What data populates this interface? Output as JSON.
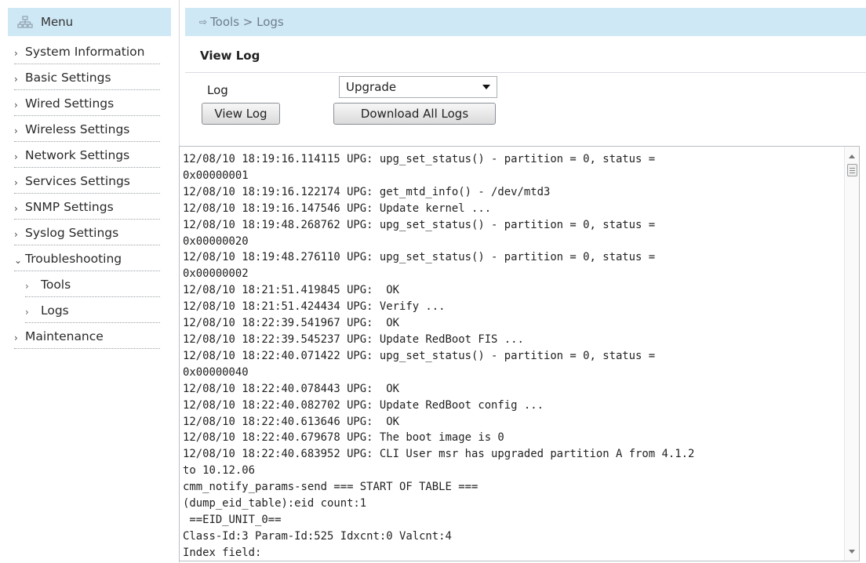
{
  "sidebar": {
    "menu_title": "Menu",
    "items": [
      {
        "label": "System Information",
        "sub": false,
        "expanded": false
      },
      {
        "label": "Basic Settings",
        "sub": false,
        "expanded": false
      },
      {
        "label": "Wired Settings",
        "sub": false,
        "expanded": false
      },
      {
        "label": "Wireless Settings",
        "sub": false,
        "expanded": false
      },
      {
        "label": "Network Settings",
        "sub": false,
        "expanded": false
      },
      {
        "label": "Services Settings",
        "sub": false,
        "expanded": false
      },
      {
        "label": "SNMP Settings",
        "sub": false,
        "expanded": false
      },
      {
        "label": "Syslog Settings",
        "sub": false,
        "expanded": false
      },
      {
        "label": "Troubleshooting",
        "sub": false,
        "expanded": true
      },
      {
        "label": "Tools",
        "sub": true,
        "expanded": false
      },
      {
        "label": "Logs",
        "sub": true,
        "expanded": false
      },
      {
        "label": "Maintenance",
        "sub": false,
        "expanded": false
      }
    ]
  },
  "breadcrumb": {
    "text": "Tools > Logs"
  },
  "page": {
    "title": "View Log",
    "log_label": "Log",
    "log_select_value": "Upgrade",
    "view_log_button": "View Log",
    "download_button": "Download All Logs"
  },
  "log": {
    "lines": [
      "12/08/10 18:19:16.114115 UPG: upg_set_status() - partition = 0, status =",
      "0x00000001",
      "12/08/10 18:19:16.122174 UPG: get_mtd_info() - /dev/mtd3",
      "12/08/10 18:19:16.147546 UPG: Update kernel ...",
      "12/08/10 18:19:48.268762 UPG: upg_set_status() - partition = 0, status =",
      "0x00000020",
      "12/08/10 18:19:48.276110 UPG: upg_set_status() - partition = 0, status =",
      "0x00000002",
      "12/08/10 18:21:51.419845 UPG:  OK",
      "12/08/10 18:21:51.424434 UPG: Verify ...",
      "12/08/10 18:22:39.541967 UPG:  OK",
      "12/08/10 18:22:39.545237 UPG: Update RedBoot FIS ...",
      "12/08/10 18:22:40.071422 UPG: upg_set_status() - partition = 0, status =",
      "0x00000040",
      "12/08/10 18:22:40.078443 UPG:  OK",
      "12/08/10 18:22:40.082702 UPG: Update RedBoot config ...",
      "12/08/10 18:22:40.613646 UPG:  OK",
      "12/08/10 18:22:40.679678 UPG: The boot image is 0",
      "12/08/10 18:22:40.683952 UPG: CLI User msr has upgraded partition A from 4.1.2",
      "to 10.12.06",
      "cmm_notify_params-send === START OF TABLE ===",
      "(dump_eid_table):eid count:1",
      " ==EID_UNIT_0==",
      "Class-Id:3 Param-Id:525 Idxcnt:0 Valcnt:4",
      "Index field:"
    ]
  },
  "icons": {
    "menu": "sitemap-icon",
    "breadcrumb": "arrow-right-icon",
    "select": "caret-down-icon"
  },
  "colors": {
    "header_bg": "#cfe8f6",
    "breadcrumb_text": "#6d7e8c"
  }
}
